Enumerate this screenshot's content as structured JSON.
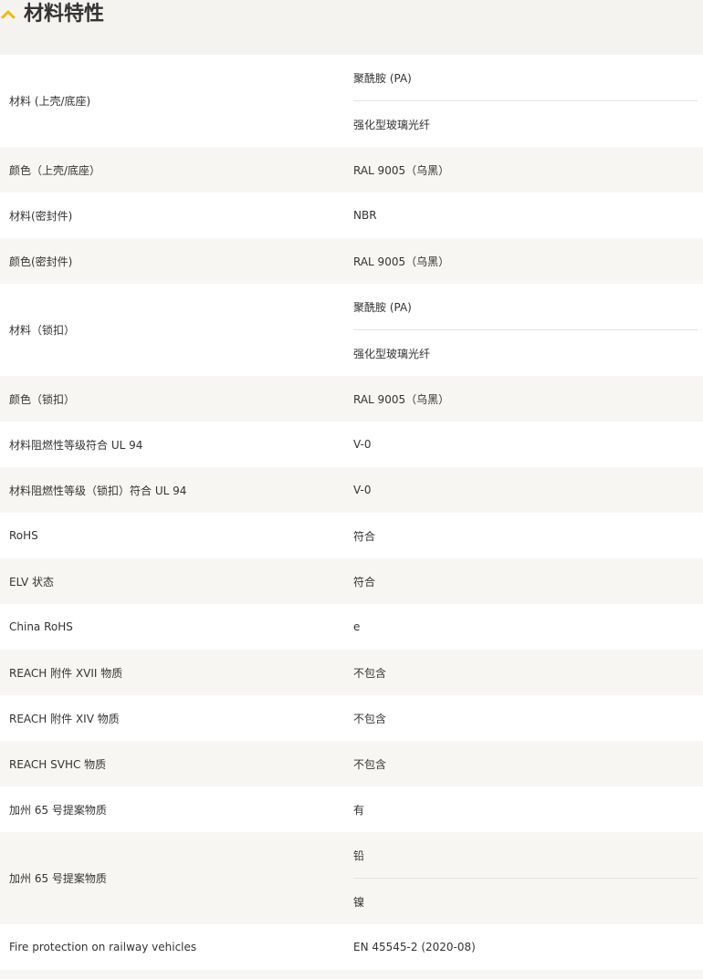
{
  "section": {
    "title": "材料特性",
    "accent": "#f5b800"
  },
  "rows": [
    {
      "label": "材料 (上壳/底座)",
      "values": [
        "聚酰胺 (PA)",
        "强化型玻璃光纤"
      ]
    },
    {
      "label": "颜色（上壳/底座）",
      "values": [
        "RAL 9005（乌黑）"
      ]
    },
    {
      "label": "材料(密封件)",
      "values": [
        "NBR"
      ]
    },
    {
      "label": "颜色(密封件)",
      "values": [
        "RAL 9005（乌黑）"
      ]
    },
    {
      "label": "材料（锁扣）",
      "values": [
        "聚酰胺 (PA)",
        "强化型玻璃光纤"
      ]
    },
    {
      "label": "颜色（锁扣）",
      "values": [
        "RAL 9005（乌黑）"
      ]
    },
    {
      "label": "材料阻燃性等级符合 UL 94",
      "values": [
        "V-0"
      ]
    },
    {
      "label": "材料阻燃性等级（锁扣）符合 UL 94",
      "values": [
        "V-0"
      ]
    },
    {
      "label": "RoHS",
      "values": [
        "符合"
      ]
    },
    {
      "label": "ELV 状态",
      "values": [
        "符合"
      ]
    },
    {
      "label": "China RoHS",
      "values": [
        "e"
      ]
    },
    {
      "label": "REACH 附件 XVII 物质",
      "values": [
        "不包含"
      ]
    },
    {
      "label": "REACH 附件 XIV 物质",
      "values": [
        "不包含"
      ]
    },
    {
      "label": "REACH SVHC 物质",
      "values": [
        "不包含"
      ]
    },
    {
      "label": "加州 65 号提案物质",
      "values": [
        "有"
      ]
    },
    {
      "label": "加州 65 号提案物质",
      "values": [
        "铅",
        "镍"
      ]
    },
    {
      "label": "Fire protection on railway vehicles",
      "values": [
        "EN 45545-2 (2020-08)"
      ]
    }
  ]
}
